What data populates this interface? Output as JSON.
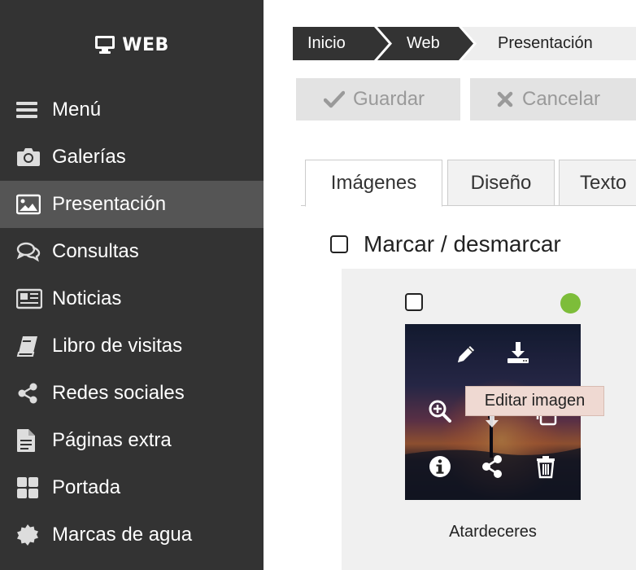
{
  "brand": {
    "icon": "monitor-icon",
    "title": "WEB"
  },
  "sidebar": {
    "items": [
      {
        "label": "Menú",
        "icon": "bars-icon"
      },
      {
        "label": "Galerías",
        "icon": "camera-icon"
      },
      {
        "label": "Presentación",
        "icon": "image-icon",
        "active": true
      },
      {
        "label": "Consultas",
        "icon": "comments-icon"
      },
      {
        "label": "Noticias",
        "icon": "newspaper-icon"
      },
      {
        "label": "Libro de visitas",
        "icon": "book-icon"
      },
      {
        "label": "Redes sociales",
        "icon": "share-icon"
      },
      {
        "label": "Páginas extra",
        "icon": "file-icon"
      },
      {
        "label": "Portada",
        "icon": "grid-icon"
      },
      {
        "label": "Marcas de agua",
        "icon": "badge-icon"
      }
    ]
  },
  "breadcrumb": [
    "Inicio",
    "Web",
    "Presentación"
  ],
  "toolbar": {
    "save_label": "Guardar",
    "cancel_label": "Cancelar"
  },
  "tabs": [
    "Imágenes",
    "Diseño",
    "Texto"
  ],
  "mark_label": "Marcar / desmarcar",
  "image_card": {
    "caption": "Atardeceres",
    "status_color": "#7dbd3a",
    "tooltip": "Editar imagen"
  },
  "colors": {
    "sidebar_bg": "#333333",
    "sidebar_active": "#555555",
    "button_bg": "#e3e3e3",
    "tooltip_bg": "#efd9d2"
  }
}
